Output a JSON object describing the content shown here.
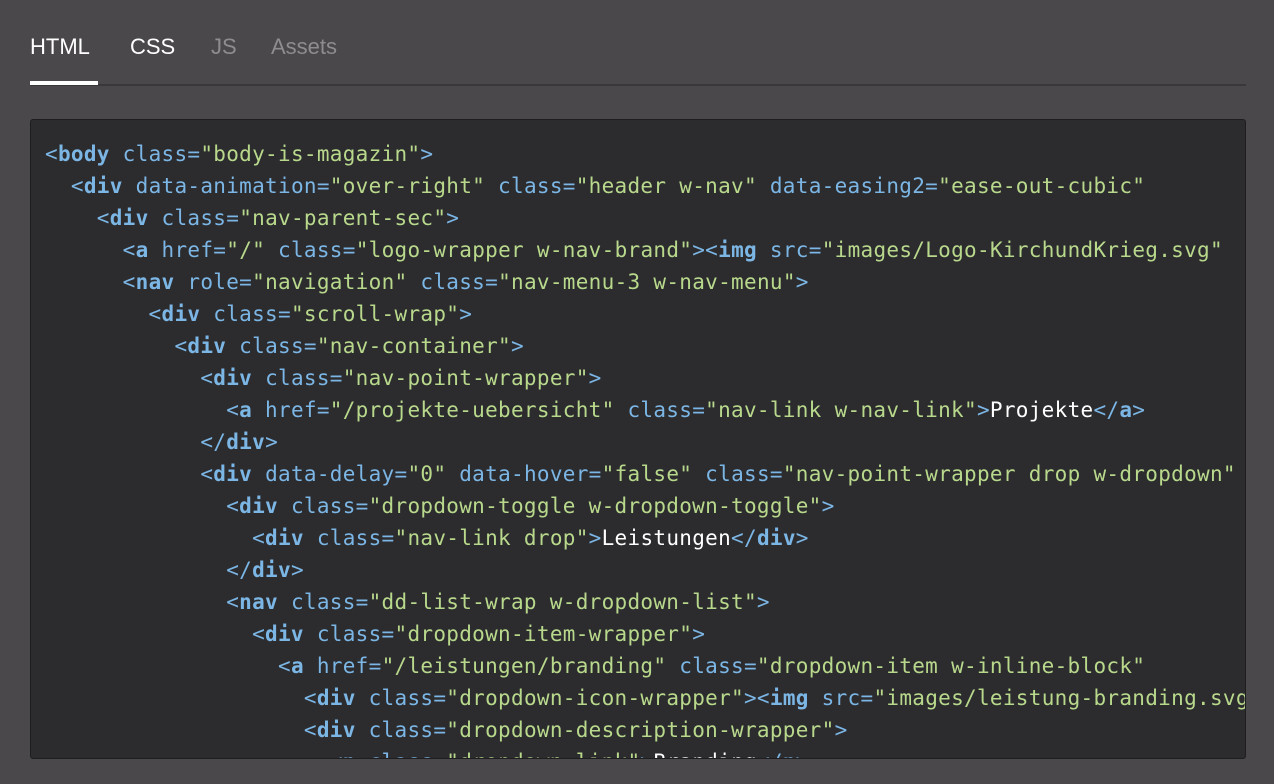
{
  "tabs": [
    {
      "label": "HTML",
      "state": "active"
    },
    {
      "label": "CSS",
      "state": "normal"
    },
    {
      "label": "JS",
      "state": "dim"
    },
    {
      "label": "Assets",
      "state": "dim"
    }
  ],
  "colors": {
    "background": "#4a484b",
    "editor_background": "#2c2b2e",
    "tag": "#7bb6e5",
    "attribute": "#7bb6e5",
    "string": "#b8d98c",
    "text": "#ffffff"
  },
  "code_lines": [
    {
      "indent": 0,
      "tokens": [
        [
          "p",
          "<"
        ],
        [
          "t",
          "body"
        ],
        [
          "a",
          " class="
        ],
        [
          "s",
          "\"body-is-magazin\""
        ],
        [
          "p",
          ">"
        ]
      ]
    },
    {
      "indent": 1,
      "tokens": [
        [
          "p",
          "<"
        ],
        [
          "t",
          "div"
        ],
        [
          "a",
          " data-animation="
        ],
        [
          "s",
          "\"over-right\""
        ],
        [
          "a",
          " class="
        ],
        [
          "s",
          "\"header w-nav\""
        ],
        [
          "a",
          " data-easing2="
        ],
        [
          "s",
          "\"ease-out-cubic\""
        ]
      ]
    },
    {
      "indent": 2,
      "tokens": [
        [
          "p",
          "<"
        ],
        [
          "t",
          "div"
        ],
        [
          "a",
          " class="
        ],
        [
          "s",
          "\"nav-parent-sec\""
        ],
        [
          "p",
          ">"
        ]
      ]
    },
    {
      "indent": 3,
      "tokens": [
        [
          "p",
          "<"
        ],
        [
          "t",
          "a"
        ],
        [
          "a",
          " href="
        ],
        [
          "s",
          "\"/\""
        ],
        [
          "a",
          " class="
        ],
        [
          "s",
          "\"logo-wrapper w-nav-brand\""
        ],
        [
          "p",
          "><"
        ],
        [
          "t",
          "img"
        ],
        [
          "a",
          " src="
        ],
        [
          "s",
          "\"images/Logo-KirchundKrieg.svg\""
        ]
      ]
    },
    {
      "indent": 3,
      "tokens": [
        [
          "p",
          "<"
        ],
        [
          "t",
          "nav"
        ],
        [
          "a",
          " role="
        ],
        [
          "s",
          "\"navigation\""
        ],
        [
          "a",
          " class="
        ],
        [
          "s",
          "\"nav-menu-3 w-nav-menu\""
        ],
        [
          "p",
          ">"
        ]
      ]
    },
    {
      "indent": 4,
      "tokens": [
        [
          "p",
          "<"
        ],
        [
          "t",
          "div"
        ],
        [
          "a",
          " class="
        ],
        [
          "s",
          "\"scroll-wrap\""
        ],
        [
          "p",
          ">"
        ]
      ]
    },
    {
      "indent": 5,
      "tokens": [
        [
          "p",
          "<"
        ],
        [
          "t",
          "div"
        ],
        [
          "a",
          " class="
        ],
        [
          "s",
          "\"nav-container\""
        ],
        [
          "p",
          ">"
        ]
      ]
    },
    {
      "indent": 6,
      "tokens": [
        [
          "p",
          "<"
        ],
        [
          "t",
          "div"
        ],
        [
          "a",
          " class="
        ],
        [
          "s",
          "\"nav-point-wrapper\""
        ],
        [
          "p",
          ">"
        ]
      ]
    },
    {
      "indent": 7,
      "tokens": [
        [
          "p",
          "<"
        ],
        [
          "t",
          "a"
        ],
        [
          "a",
          " href="
        ],
        [
          "s",
          "\"/projekte-uebersicht\""
        ],
        [
          "a",
          " class="
        ],
        [
          "s",
          "\"nav-link w-nav-link\""
        ],
        [
          "p",
          ">"
        ],
        [
          "x",
          "Projekte"
        ],
        [
          "p",
          "</"
        ],
        [
          "t",
          "a"
        ],
        [
          "p",
          ">"
        ]
      ]
    },
    {
      "indent": 6,
      "tokens": [
        [
          "p",
          "</"
        ],
        [
          "t",
          "div"
        ],
        [
          "p",
          ">"
        ]
      ]
    },
    {
      "indent": 6,
      "tokens": [
        [
          "p",
          "<"
        ],
        [
          "t",
          "div"
        ],
        [
          "a",
          " data-delay="
        ],
        [
          "s",
          "\"0\""
        ],
        [
          "a",
          " data-hover="
        ],
        [
          "s",
          "\"false\""
        ],
        [
          "a",
          " class="
        ],
        [
          "s",
          "\"nav-point-wrapper drop w-dropdown\""
        ]
      ]
    },
    {
      "indent": 7,
      "tokens": [
        [
          "p",
          "<"
        ],
        [
          "t",
          "div"
        ],
        [
          "a",
          " class="
        ],
        [
          "s",
          "\"dropdown-toggle w-dropdown-toggle\""
        ],
        [
          "p",
          ">"
        ]
      ]
    },
    {
      "indent": 8,
      "tokens": [
        [
          "p",
          "<"
        ],
        [
          "t",
          "div"
        ],
        [
          "a",
          " class="
        ],
        [
          "s",
          "\"nav-link drop\""
        ],
        [
          "p",
          ">"
        ],
        [
          "x",
          "Leistungen"
        ],
        [
          "p",
          "</"
        ],
        [
          "t",
          "div"
        ],
        [
          "p",
          ">"
        ]
      ]
    },
    {
      "indent": 7,
      "tokens": [
        [
          "p",
          "</"
        ],
        [
          "t",
          "div"
        ],
        [
          "p",
          ">"
        ]
      ]
    },
    {
      "indent": 7,
      "tokens": [
        [
          "p",
          "<"
        ],
        [
          "t",
          "nav"
        ],
        [
          "a",
          " class="
        ],
        [
          "s",
          "\"dd-list-wrap w-dropdown-list\""
        ],
        [
          "p",
          ">"
        ]
      ]
    },
    {
      "indent": 8,
      "tokens": [
        [
          "p",
          "<"
        ],
        [
          "t",
          "div"
        ],
        [
          "a",
          " class="
        ],
        [
          "s",
          "\"dropdown-item-wrapper\""
        ],
        [
          "p",
          ">"
        ]
      ]
    },
    {
      "indent": 9,
      "tokens": [
        [
          "p",
          "<"
        ],
        [
          "t",
          "a"
        ],
        [
          "a",
          " href="
        ],
        [
          "s",
          "\"/leistungen/branding\""
        ],
        [
          "a",
          " class="
        ],
        [
          "s",
          "\"dropdown-item w-inline-block\""
        ]
      ]
    },
    {
      "indent": 10,
      "tokens": [
        [
          "p",
          "<"
        ],
        [
          "t",
          "div"
        ],
        [
          "a",
          " class="
        ],
        [
          "s",
          "\"dropdown-icon-wrapper\""
        ],
        [
          "p",
          "><"
        ],
        [
          "t",
          "img"
        ],
        [
          "a",
          " src="
        ],
        [
          "s",
          "\"images/leistung-branding.svg\""
        ]
      ]
    },
    {
      "indent": 10,
      "tokens": [
        [
          "p",
          "<"
        ],
        [
          "t",
          "div"
        ],
        [
          "a",
          " class="
        ],
        [
          "s",
          "\"dropdown-description-wrapper\""
        ],
        [
          "p",
          ">"
        ]
      ]
    },
    {
      "indent": 11,
      "tokens": [
        [
          "p",
          "<"
        ],
        [
          "t",
          "p"
        ],
        [
          "a",
          " class="
        ],
        [
          "s",
          "\"dropdown-link\""
        ],
        [
          "p",
          ">"
        ],
        [
          "x",
          "Branding"
        ],
        [
          "p",
          "</"
        ],
        [
          "t",
          "p"
        ],
        [
          "p",
          ">"
        ]
      ]
    }
  ]
}
